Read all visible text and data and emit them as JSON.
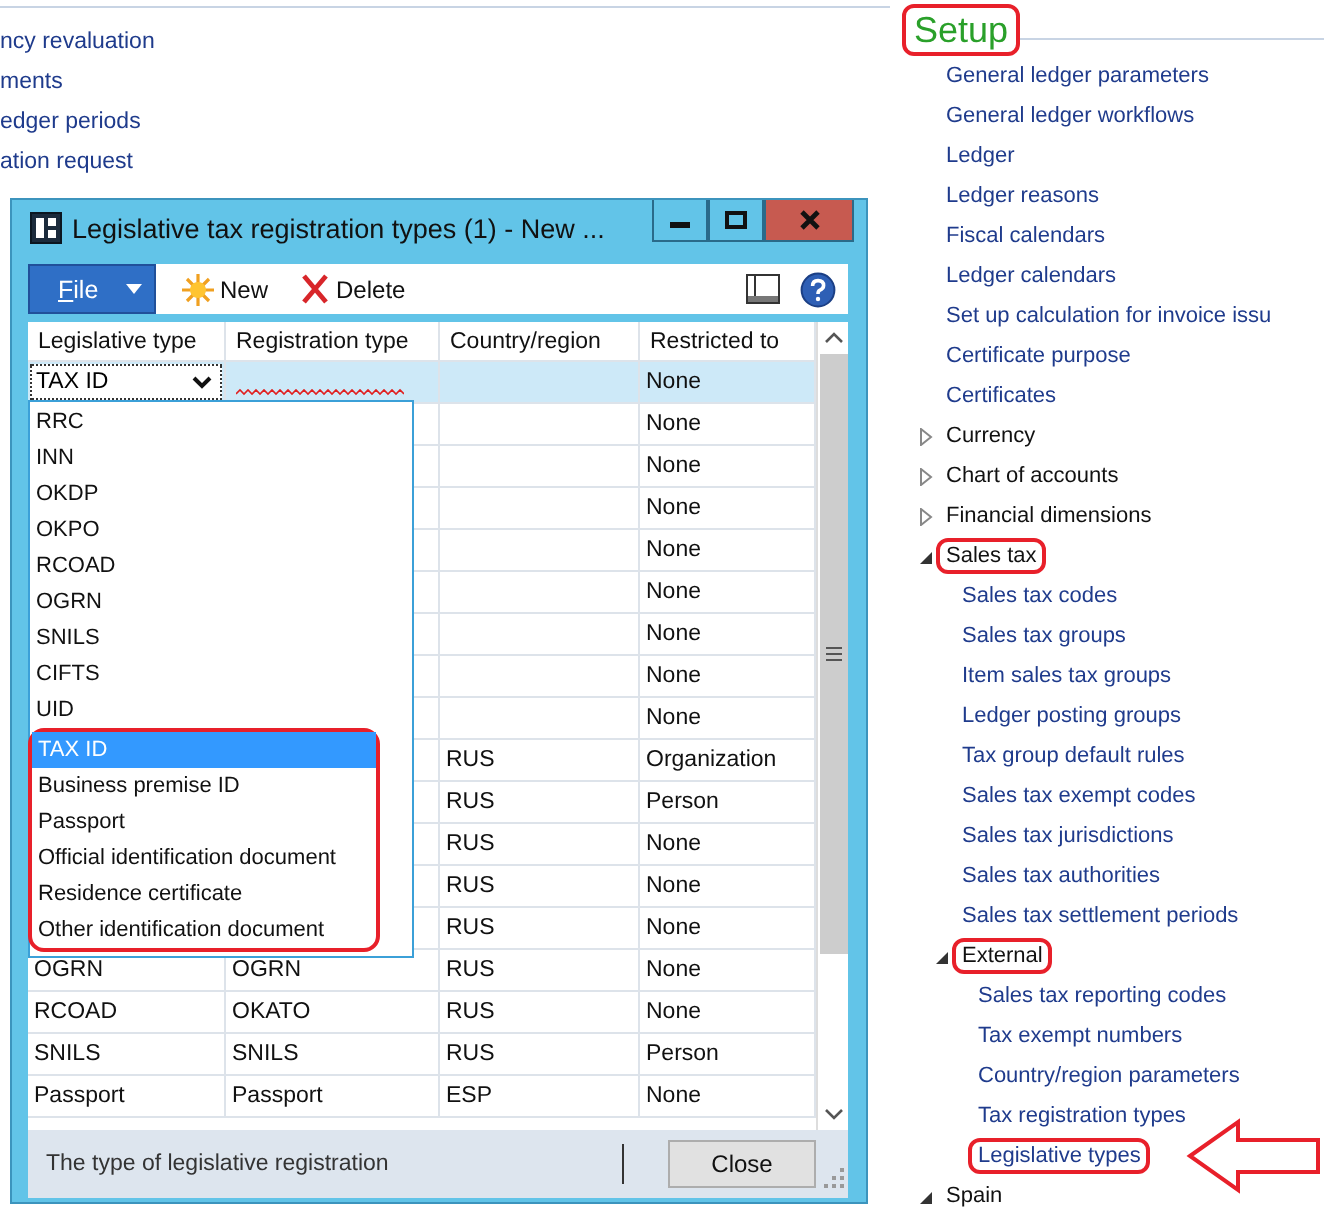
{
  "background_links": [
    "ncy revaluation",
    "ments",
    "edger periods",
    "ation request"
  ],
  "dialog": {
    "title": "Legislative tax registration types (1) - New ...",
    "toolbar": {
      "file": "File",
      "new": "New",
      "delete": "Delete"
    },
    "columns": [
      "Legislative type",
      "Registration type",
      "Country/region",
      "Restricted to"
    ],
    "rows": [
      {
        "legislative": "TAX ID",
        "restricted": "None",
        "selected": true,
        "editing": true
      },
      {
        "restricted": "None",
        "selected": false
      },
      {
        "restricted": "None",
        "selected": false
      },
      {
        "restricted": "None",
        "selected": false
      },
      {
        "restricted": "None",
        "selected": false
      },
      {
        "restricted": "None",
        "selected": false
      },
      {
        "restricted": "None",
        "selected": false
      },
      {
        "restricted": "None",
        "selected": false
      },
      {
        "restricted": "None",
        "selected": false
      },
      {
        "country": "RUS",
        "restricted": "Organization",
        "selected": false
      },
      {
        "country": "RUS",
        "restricted": "Person",
        "selected": false
      },
      {
        "country": "RUS",
        "restricted": "None",
        "selected": false
      },
      {
        "country": "RUS",
        "restricted": "None",
        "selected": false
      },
      {
        "country": "RUS",
        "restricted": "None",
        "selected": false
      },
      {
        "legislative": "OGRN",
        "registration": "OGRN",
        "country": "RUS",
        "restricted": "None",
        "selected": false
      },
      {
        "legislative": "RCOAD",
        "registration": "OKATO",
        "country": "RUS",
        "restricted": "None",
        "selected": false
      },
      {
        "legislative": "SNILS",
        "registration": "SNILS",
        "country": "RUS",
        "restricted": "Person",
        "selected": false
      },
      {
        "legislative": "Passport",
        "registration": "Passport",
        "country": "ESP",
        "restricted": "None",
        "selected": false
      }
    ],
    "dropdown": {
      "items": [
        {
          "label": "RRC",
          "selected": false,
          "annotated": false
        },
        {
          "label": "INN",
          "selected": false,
          "annotated": false
        },
        {
          "label": "OKDP",
          "selected": false,
          "annotated": false
        },
        {
          "label": "OKPO",
          "selected": false,
          "annotated": false
        },
        {
          "label": "RCOAD",
          "selected": false,
          "annotated": false
        },
        {
          "label": "OGRN",
          "selected": false,
          "annotated": false
        },
        {
          "label": "SNILS",
          "selected": false,
          "annotated": false
        },
        {
          "label": "CIFTS",
          "selected": false,
          "annotated": false
        },
        {
          "label": "UID",
          "selected": false,
          "annotated": false
        },
        {
          "label": "TAX ID",
          "selected": true,
          "annotated": true
        },
        {
          "label": "Business premise ID",
          "selected": false,
          "annotated": true
        },
        {
          "label": "Passport",
          "selected": false,
          "annotated": true
        },
        {
          "label": "Official identification document",
          "selected": false,
          "annotated": true
        },
        {
          "label": "Residence certificate",
          "selected": false,
          "annotated": true
        },
        {
          "label": "Other identification document",
          "selected": false,
          "annotated": true
        }
      ]
    },
    "status": "The type of legislative registration",
    "close": "Close"
  },
  "nav": {
    "heading": "Setup",
    "heading_annotated": true,
    "items": [
      {
        "label": "General ledger parameters",
        "kind": "link"
      },
      {
        "label": "General ledger workflows",
        "kind": "link"
      },
      {
        "label": "Ledger",
        "kind": "link"
      },
      {
        "label": "Ledger reasons",
        "kind": "link"
      },
      {
        "label": "Fiscal calendars",
        "kind": "link"
      },
      {
        "label": "Ledger calendars",
        "kind": "link"
      },
      {
        "label": "Set up calculation for invoice issu",
        "kind": "link"
      },
      {
        "label": "Certificate purpose",
        "kind": "link"
      },
      {
        "label": "Certificates",
        "kind": "link"
      },
      {
        "label": "Currency",
        "kind": "group",
        "expanded": false
      },
      {
        "label": "Chart of accounts",
        "kind": "group",
        "expanded": false
      },
      {
        "label": "Financial dimensions",
        "kind": "group",
        "expanded": false
      },
      {
        "label": "Sales tax",
        "kind": "group",
        "expanded": true,
        "annotated": true,
        "children": [
          {
            "label": "Sales tax codes",
            "kind": "link"
          },
          {
            "label": "Sales tax groups",
            "kind": "link"
          },
          {
            "label": "Item sales tax groups",
            "kind": "link"
          },
          {
            "label": "Ledger posting groups",
            "kind": "link"
          },
          {
            "label": "Tax group default rules",
            "kind": "link"
          },
          {
            "label": "Sales tax exempt codes",
            "kind": "link"
          },
          {
            "label": "Sales tax jurisdictions",
            "kind": "link"
          },
          {
            "label": "Sales tax authorities",
            "kind": "link"
          },
          {
            "label": "Sales tax settlement periods",
            "kind": "link"
          },
          {
            "label": "External",
            "kind": "group",
            "expanded": true,
            "annotated": true,
            "children": [
              {
                "label": "Sales tax reporting codes",
                "kind": "link"
              },
              {
                "label": "Tax exempt numbers",
                "kind": "link"
              },
              {
                "label": "Country/region parameters",
                "kind": "link"
              },
              {
                "label": "Tax registration types",
                "kind": "link"
              },
              {
                "label": "Legislative types",
                "kind": "link",
                "annotated": true,
                "arrow": true
              }
            ]
          }
        ]
      },
      {
        "label": "Spain",
        "kind": "group",
        "expanded": true
      }
    ]
  }
}
